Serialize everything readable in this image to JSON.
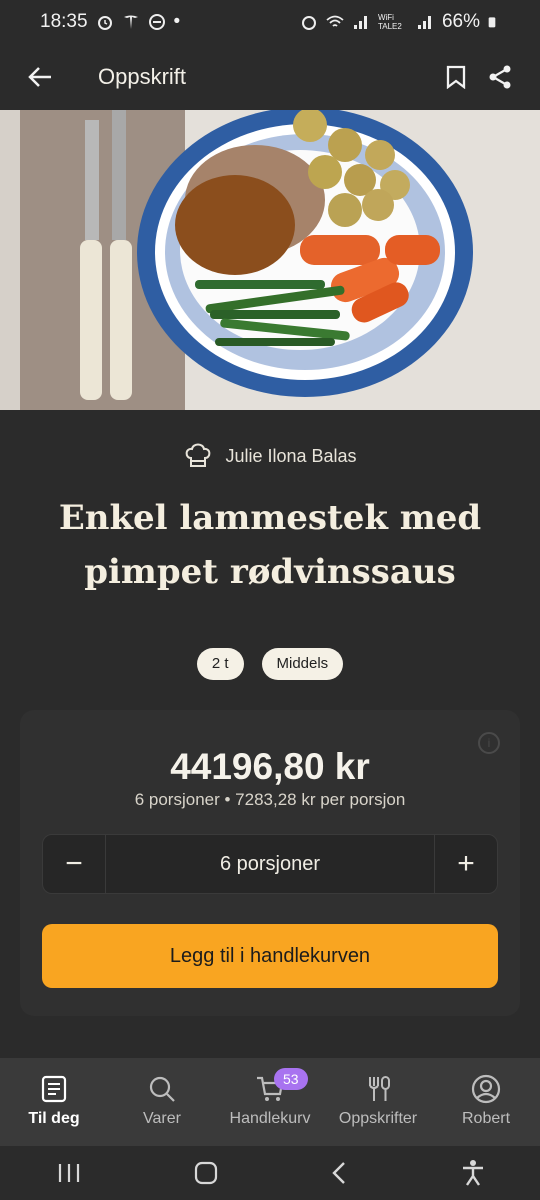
{
  "status": {
    "time": "18:35",
    "dot": "•",
    "wifi_label": "WiFi TALE2",
    "battery": "66%"
  },
  "appbar": {
    "title": "Oppskrift"
  },
  "author": {
    "name": "Julie Ilona Balas"
  },
  "recipe": {
    "title_line1": "Enkel lammestek med",
    "title_line2": "pimpet rødvinssaus",
    "tags": [
      "2 t",
      "Middels"
    ]
  },
  "card": {
    "price": "44196,80 kr",
    "subline": "6 porsjoner • 7283,28 kr per porsjon",
    "stepper": {
      "minus": "−",
      "value": "6 porsjoner",
      "plus": "+"
    },
    "cta_label": "Legg til i handlekurven"
  },
  "nav": {
    "items": [
      {
        "label": "Til deg",
        "icon": "newspaper-icon",
        "active": true
      },
      {
        "label": "Varer",
        "icon": "search-icon"
      },
      {
        "label": "Handlekurv",
        "icon": "cart-icon",
        "badge": "53"
      },
      {
        "label": "Oppskrifter",
        "icon": "cutlery-icon"
      },
      {
        "label": "Robert",
        "icon": "profile-icon"
      }
    ]
  },
  "colors": {
    "accent": "#f9a521",
    "badge": "#a873f0",
    "background": "#2b2b2b"
  }
}
